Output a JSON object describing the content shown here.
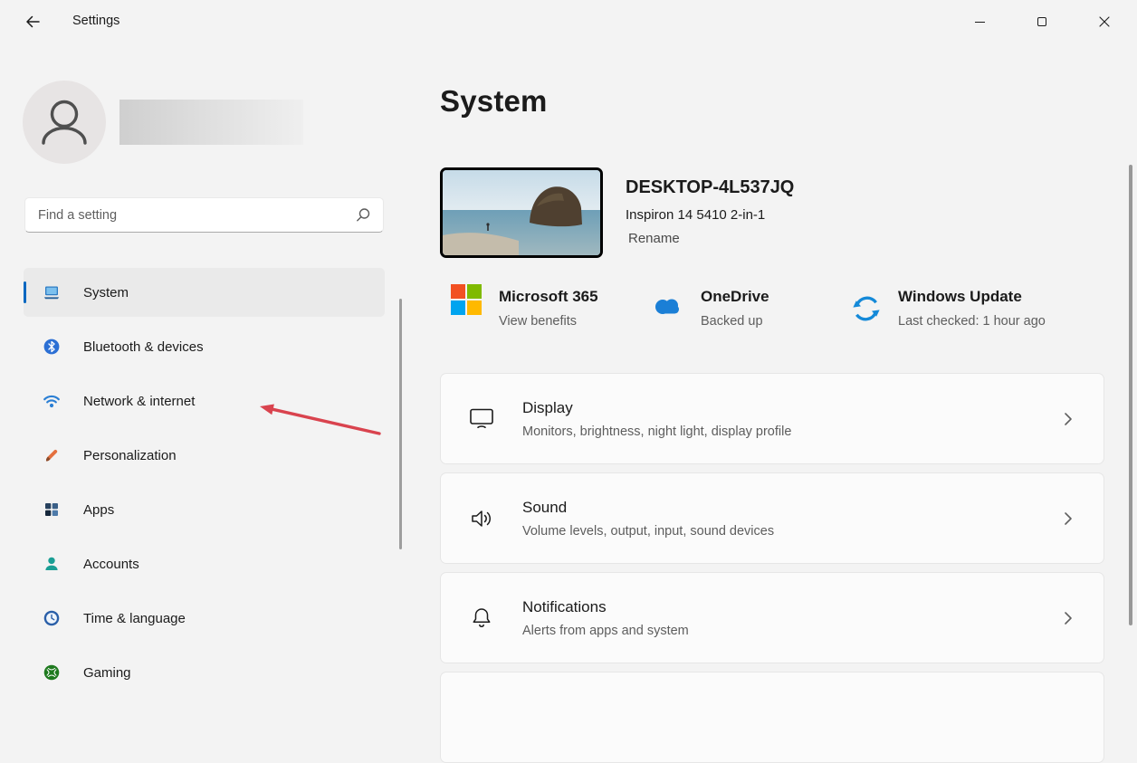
{
  "titlebar": {
    "title": "Settings"
  },
  "colors": {
    "accent": "#0067c0",
    "annotation_arrow": "#d9434e",
    "selected_item_bg": "#eaeaea"
  },
  "sidebar": {
    "search_placeholder": "Find a setting",
    "items": [
      {
        "label": "System",
        "icon": "system-icon",
        "selected": true
      },
      {
        "label": "Bluetooth & devices",
        "icon": "bluetooth-icon",
        "selected": false
      },
      {
        "label": "Network & internet",
        "icon": "network-icon",
        "selected": false
      },
      {
        "label": "Personalization",
        "icon": "personalization-icon",
        "selected": false
      },
      {
        "label": "Apps",
        "icon": "apps-icon",
        "selected": false
      },
      {
        "label": "Accounts",
        "icon": "accounts-icon",
        "selected": false
      },
      {
        "label": "Time & language",
        "icon": "time-language-icon",
        "selected": false
      },
      {
        "label": "Gaming",
        "icon": "gaming-icon",
        "selected": false
      }
    ]
  },
  "main": {
    "page_title": "System",
    "device": {
      "name": "DESKTOP-4L537JQ",
      "model": "Inspiron 14 5410 2-in-1",
      "rename_label": "Rename"
    },
    "status_items": [
      {
        "title": "Microsoft 365",
        "subtitle": "View benefits",
        "icon": "microsoft-365-icon"
      },
      {
        "title": "OneDrive",
        "subtitle": "Backed up",
        "icon": "onedrive-icon"
      },
      {
        "title": "Windows Update",
        "subtitle": "Last checked: 1 hour ago",
        "icon": "windows-update-icon"
      }
    ],
    "cards": [
      {
        "title": "Display",
        "subtitle": "Monitors, brightness, night light, display profile",
        "icon": "display-icon"
      },
      {
        "title": "Sound",
        "subtitle": "Volume levels, output, input, sound devices",
        "icon": "sound-icon"
      },
      {
        "title": "Notifications",
        "subtitle": "Alerts from apps and system",
        "icon": "notifications-icon"
      }
    ]
  }
}
